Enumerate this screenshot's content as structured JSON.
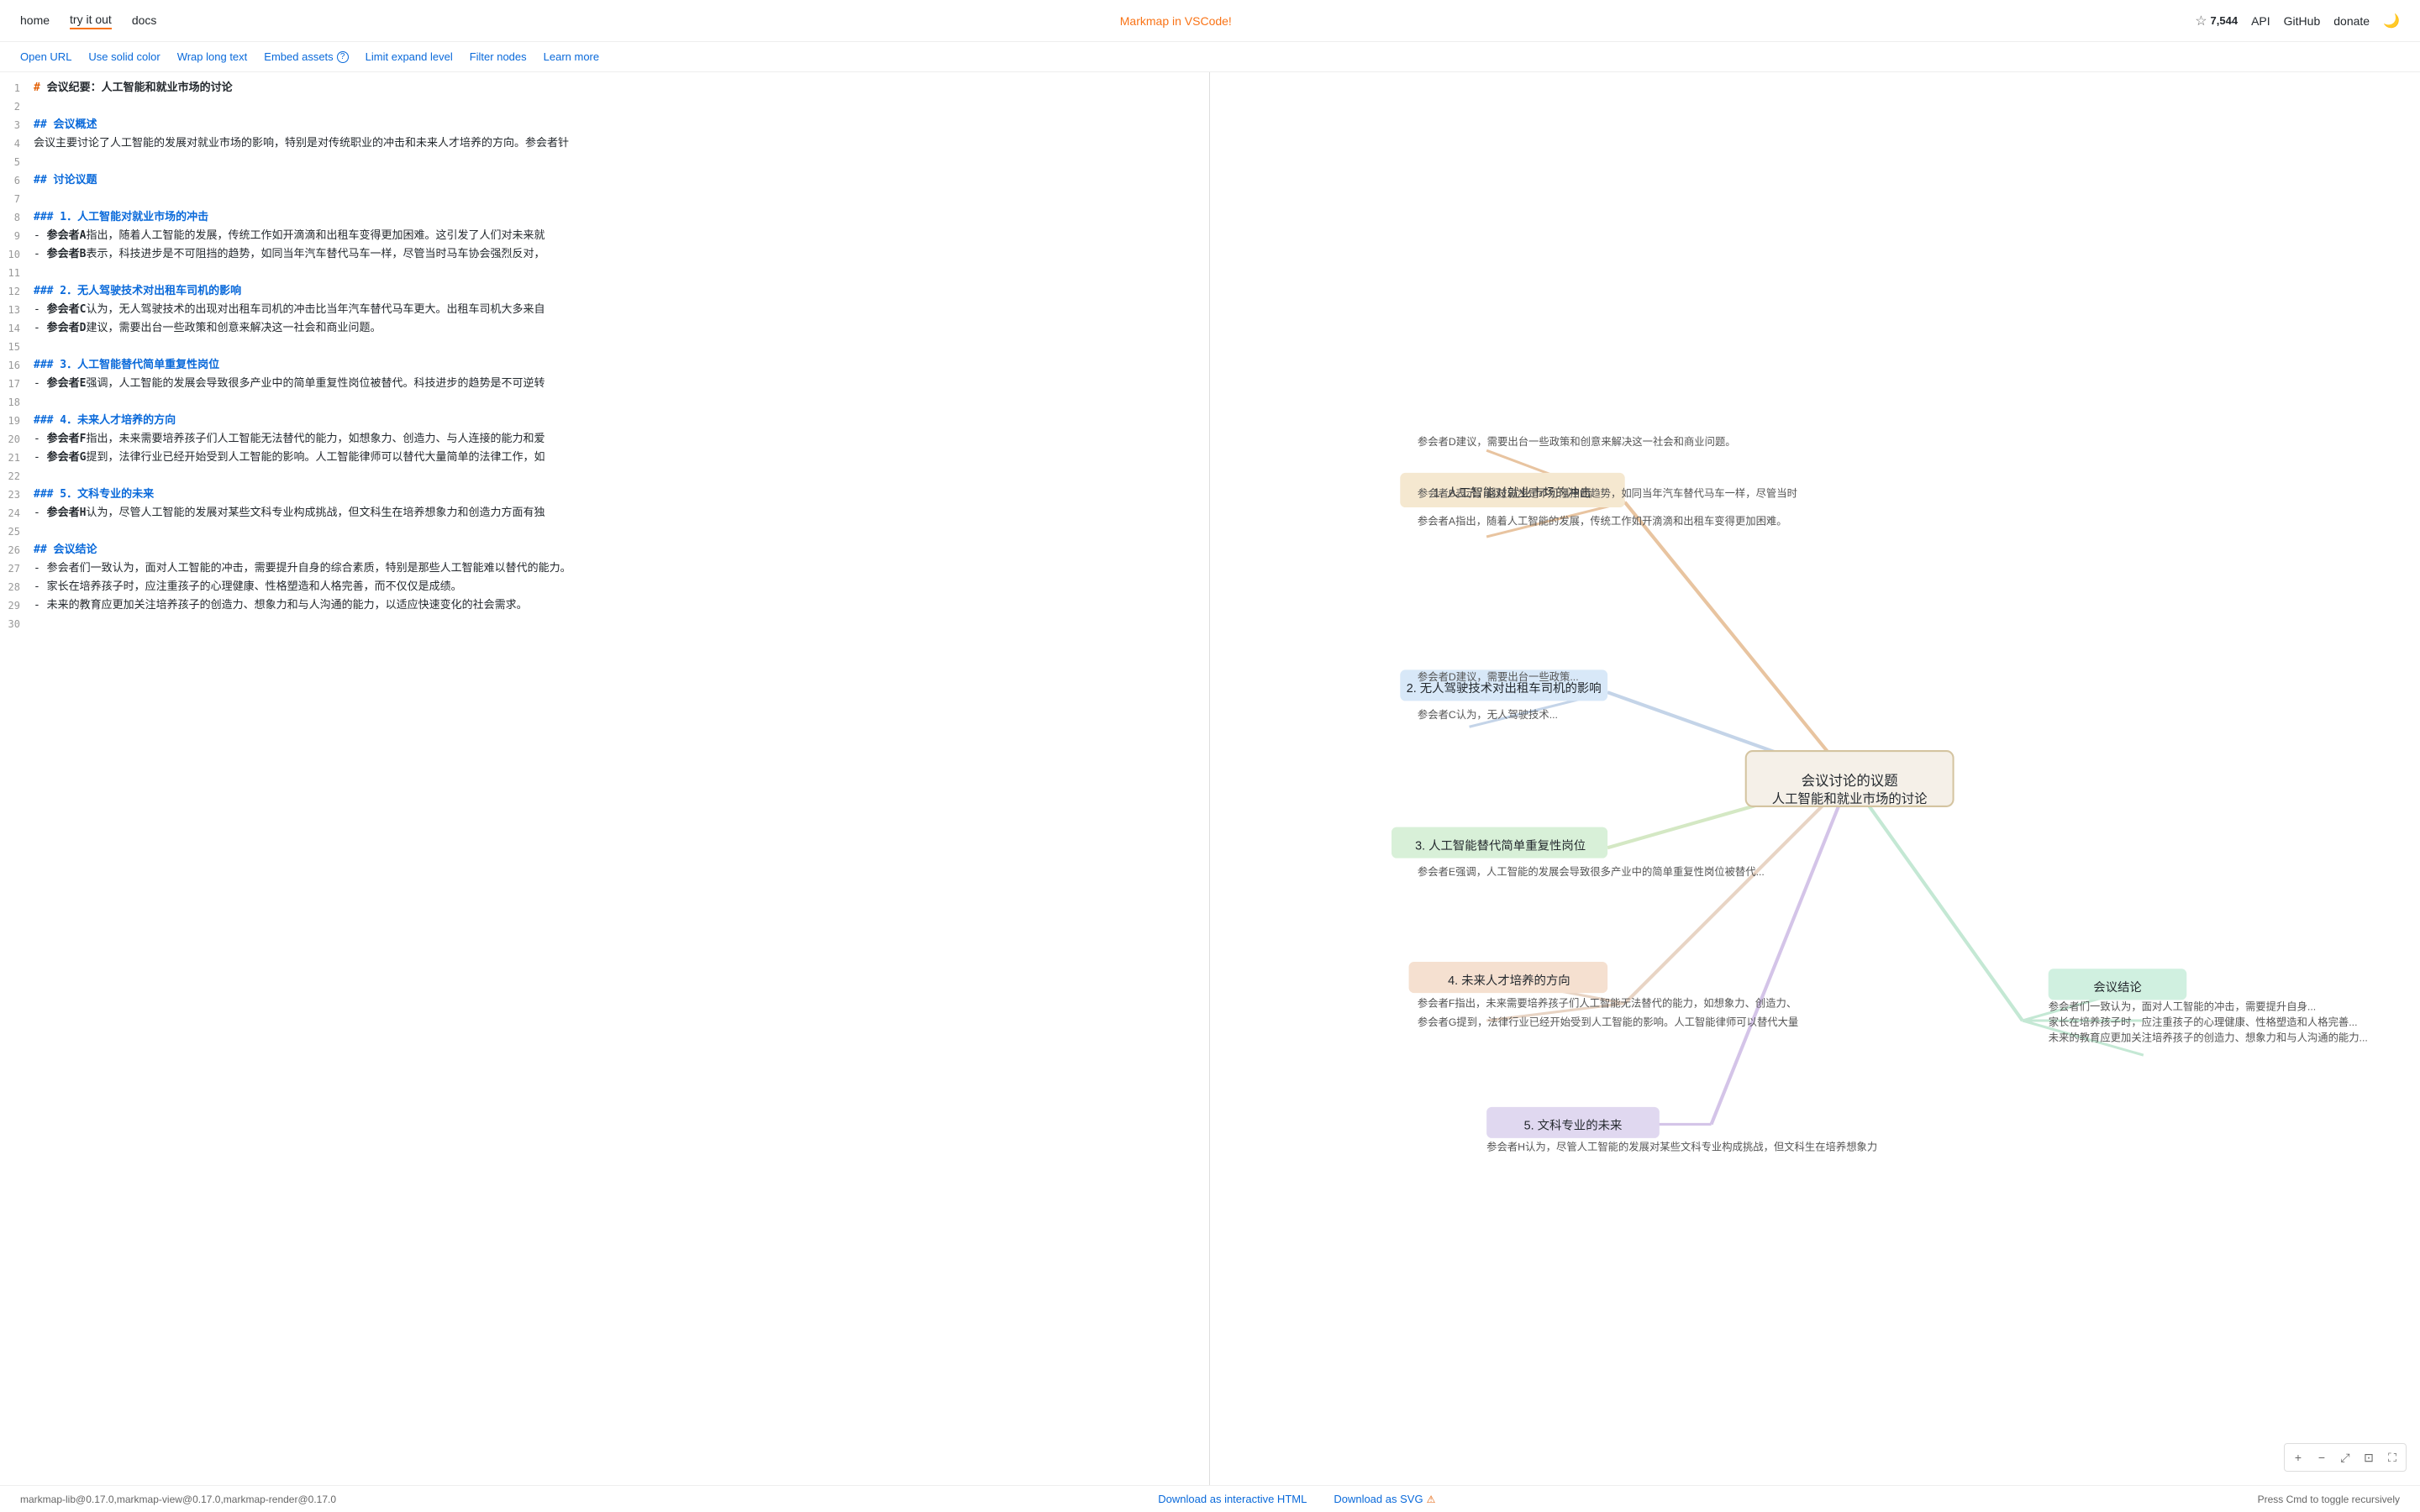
{
  "nav": {
    "links": [
      {
        "id": "home",
        "label": "home",
        "active": false
      },
      {
        "id": "try-it-out",
        "label": "try it out",
        "active": true
      },
      {
        "id": "docs",
        "label": "docs",
        "active": false
      }
    ],
    "center_title": "Markmap in VSCode!",
    "center_url": "#",
    "right": {
      "star_label": "7,544",
      "api_label": "API",
      "github_label": "GitHub",
      "donate_label": "donate"
    }
  },
  "toolbar": {
    "links": [
      {
        "id": "open-url",
        "label": "Open URL",
        "has_badge": false
      },
      {
        "id": "use-solid-color",
        "label": "Use solid color",
        "has_badge": false
      },
      {
        "id": "wrap-long-text",
        "label": "Wrap long text",
        "has_badge": false
      },
      {
        "id": "embed-assets",
        "label": "Embed assets",
        "has_badge": true
      },
      {
        "id": "limit-expand-level",
        "label": "Limit expand level",
        "has_badge": false
      },
      {
        "id": "filter-nodes",
        "label": "Filter nodes",
        "has_badge": false
      },
      {
        "id": "learn-more",
        "label": "Learn more",
        "has_badge": false
      }
    ]
  },
  "editor": {
    "lines": [
      {
        "num": 1,
        "type": "h1",
        "content": "# 会议纪要：人工智能和就业市场的讨论"
      },
      {
        "num": 2,
        "type": "empty",
        "content": ""
      },
      {
        "num": 3,
        "type": "h2",
        "content": "## 会议概述"
      },
      {
        "num": 4,
        "type": "normal",
        "content": "会议主要讨论了人工智能的发展对就业市场的影响，特别是对传统职业的冲击和未来人才培养的方向。参会者针"
      },
      {
        "num": 5,
        "type": "empty",
        "content": ""
      },
      {
        "num": 6,
        "type": "h2",
        "content": "## 讨论议题"
      },
      {
        "num": 7,
        "type": "empty",
        "content": ""
      },
      {
        "num": 8,
        "type": "h3",
        "content": "### 1．人工智能对就业市场的冲击"
      },
      {
        "num": 9,
        "type": "normal",
        "content": "- **参会者A**指出，随着人工智能的发展，传统工作如开滴滴和出租车变得更加困难。这引发了人们对未来就"
      },
      {
        "num": 10,
        "type": "normal",
        "content": "- **参会者B**表示，科技进步是不可阻挡的趋势，如同当年汽车替代马车一样，尽管当时马车协会强烈反对，"
      },
      {
        "num": 11,
        "type": "empty",
        "content": ""
      },
      {
        "num": 12,
        "type": "h3",
        "content": "### 2．无人驾驶技术对出租车司机的影响"
      },
      {
        "num": 13,
        "type": "normal",
        "content": "- **参会者C**认为，无人驾驶技术的出现对出租车司机的冲击比当年汽车替代马车更大。出租车司机大多来自"
      },
      {
        "num": 14,
        "type": "normal",
        "content": "- **参会者D**建议，需要出台一些政策和创意来解决这一社会和商业问题。"
      },
      {
        "num": 15,
        "type": "empty",
        "content": ""
      },
      {
        "num": 16,
        "type": "h3",
        "content": "### 3．人工智能替代简单重复性岗位"
      },
      {
        "num": 17,
        "type": "normal",
        "content": "- **参会者E**强调，人工智能的发展会导致很多产业中的简单重复性岗位被替代。科技进步的趋势是不可逆转"
      },
      {
        "num": 18,
        "type": "empty",
        "content": ""
      },
      {
        "num": 19,
        "type": "h3",
        "content": "### 4．未来人才培养的方向"
      },
      {
        "num": 20,
        "type": "normal",
        "content": "- **参会者F**指出，未来需要培养孩子们人工智能无法替代的能力，如想象力、创造力、与人连接的能力和爱"
      },
      {
        "num": 21,
        "type": "normal",
        "content": "- **参会者G**提到，法律行业已经开始受到人工智能的影响。人工智能律师可以替代大量简单的法律工作，如"
      },
      {
        "num": 22,
        "type": "empty",
        "content": ""
      },
      {
        "num": 23,
        "type": "h3",
        "content": "### 5．文科专业的未来"
      },
      {
        "num": 24,
        "type": "normal",
        "content": "- **参会者H**认为，尽管人工智能的发展对某些文科专业构成挑战，但文科生在培养想象力和创造力方面有独"
      },
      {
        "num": 25,
        "type": "empty",
        "content": ""
      },
      {
        "num": 26,
        "type": "h2",
        "content": "## 会议结论"
      },
      {
        "num": 27,
        "type": "normal",
        "content": "- 参会者们一致认为，面对人工智能的冲击，需要提升自身的综合素质，特别是那些人工智能难以替代的能力。"
      },
      {
        "num": 28,
        "type": "normal",
        "content": "- 家长在培养孩子时，应注重孩子的心理健康、性格塑造和人格完善，而不仅仅是成绩。"
      },
      {
        "num": 29,
        "type": "normal",
        "content": "- 未来的教育应更加关注培养孩子的创造力、想象力和与人沟通的能力，以适应快速变化的社会需求。"
      },
      {
        "num": 30,
        "type": "empty",
        "content": ""
      }
    ]
  },
  "bottom": {
    "version": "markmap-lib@0.17.0,markmap-view@0.17.0,markmap-render@0.17.0",
    "download_html": "Download as interactive HTML",
    "download_svg": "Download as SVG",
    "keyboard_hint": "Press Cmd to toggle recursively"
  },
  "zoom_controls": [
    "+",
    "−",
    "⤢",
    "⊡",
    "⛶"
  ]
}
